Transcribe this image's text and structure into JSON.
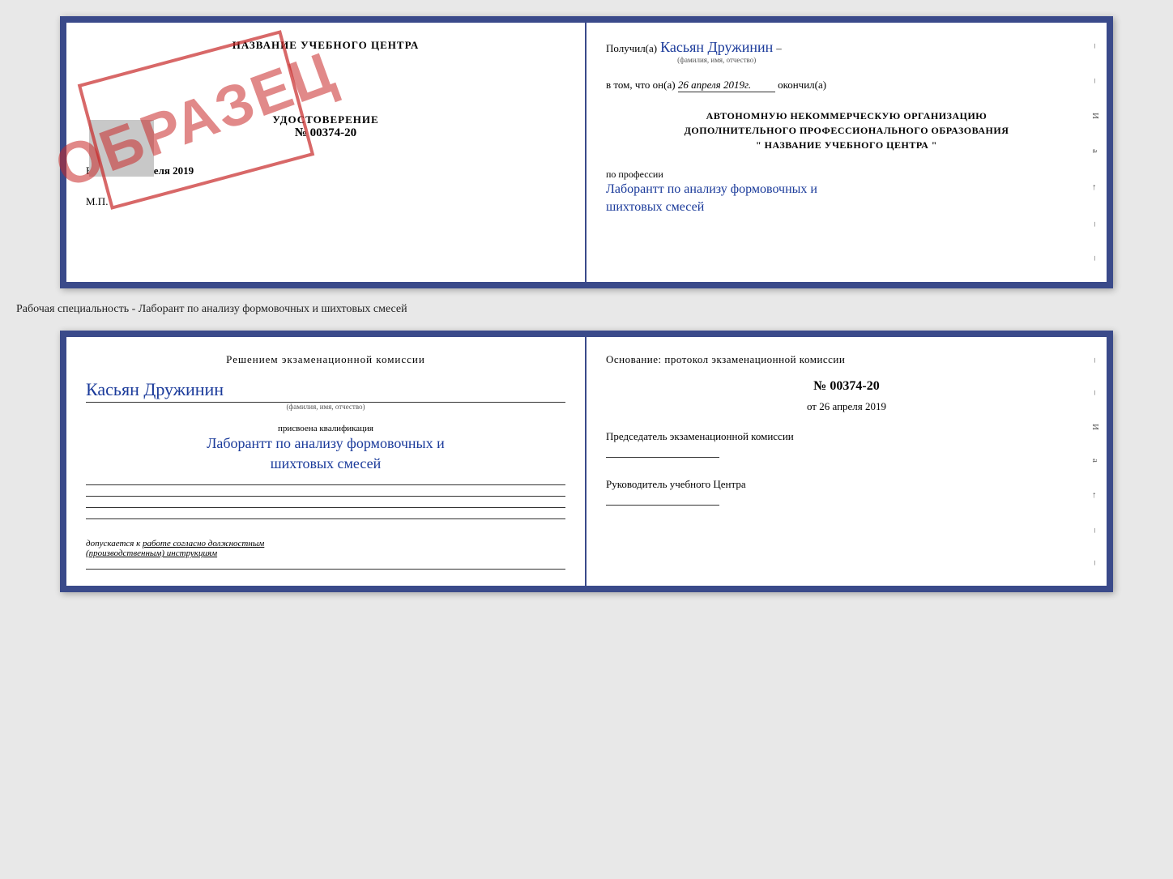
{
  "top_left": {
    "title": "НАЗВАНИЕ УЧЕБНОГО ЦЕНТРА",
    "udost_label": "УДОСТОВЕРЕНИЕ",
    "number": "№ 00374-20",
    "vydano_label": "Выдано",
    "vydano_date": "26 апреля 2019",
    "mp": "М.П.",
    "stamp": "ОБРАЗЕЦ"
  },
  "top_right": {
    "poluchil_label": "Получил(а)",
    "name_handwritten": "Касьян Дружинин",
    "fio_sub": "(фамилия, имя, отчество)",
    "vtom_label": "в том, что он(а)",
    "date_value": "26 апреля 2019г.",
    "okonchil_label": "окончил(а)",
    "org_line1": "АВТОНОМНУЮ НЕКОММЕРЧЕСКУЮ ОРГАНИЗАЦИЮ",
    "org_line2": "ДОПОЛНИТЕЛЬНОГО ПРОФЕССИОНАЛЬНОГО ОБРАЗОВАНИЯ",
    "org_line3": "\" НАЗВАНИЕ УЧЕБНОГО ЦЕНТРА \"",
    "po_professii_label": "по профессии",
    "prof_handwritten1": "Лаборантт по анализу формовочных и",
    "prof_handwritten2": "шихтовых смесей",
    "sidebar_chars": [
      "И",
      "а",
      "←"
    ]
  },
  "specialty_text": "Рабочая специальность - Лаборант по анализу формовочных и шихтовых смесей",
  "bottom_left": {
    "resheniem_label": "Решением экзаменационной комиссии",
    "name_handwritten": "Касьян Дружинин",
    "fio_sub": "(фамилия, имя, отчество)",
    "prisvoena_label": "присвоена квалификация",
    "qual_handwritten1": "Лаборантт по анализу формовочных и",
    "qual_handwritten2": "шихтовых смесей",
    "dopuskaetsya_text": "допускается к работе согласно должностным (производственным) инструкциям"
  },
  "bottom_right": {
    "osnovanie_label": "Основание: протокол экзаменационной комиссии",
    "number_label": "№ 00374-20",
    "ot_label": "от",
    "ot_date": "26 апреля 2019",
    "predsedatel_label": "Председатель экзаменационной комиссии",
    "rukovoditel_label": "Руководитель учебного Центра",
    "sidebar_chars": [
      "И",
      "а",
      "←"
    ]
  }
}
